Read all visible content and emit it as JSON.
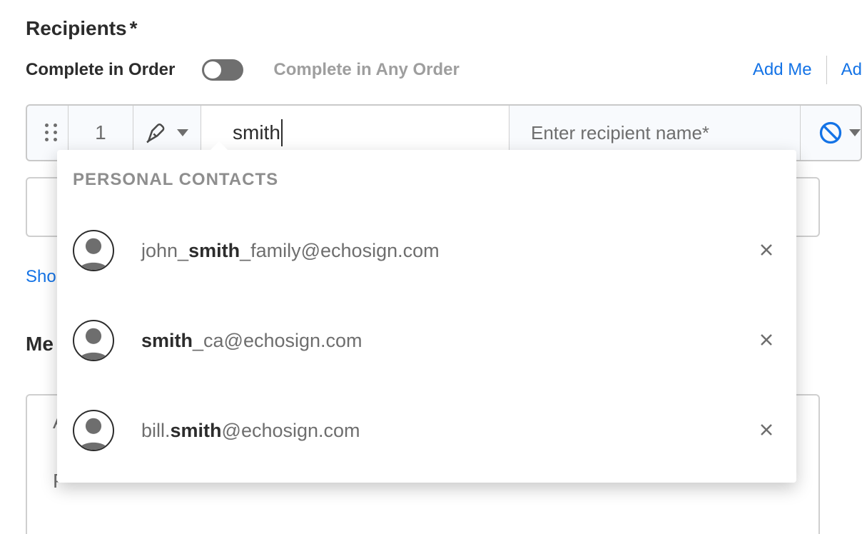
{
  "section": {
    "title": "Recipients",
    "required_mark": "*"
  },
  "order": {
    "on_label": "Complete in Order",
    "off_label": "Complete in Any Order",
    "toggle_on": true
  },
  "actions": {
    "add_me": "Add Me",
    "add_more": "Ad"
  },
  "recipient_row": {
    "index": "1",
    "email_input_value": "smith",
    "name_placeholder": "Enter recipient name*",
    "role_icon": "pen-sign-icon",
    "end_icon": "prohibit-icon"
  },
  "below": {
    "show_cc_prefix": "Sho",
    "message_heading_prefix": "Me",
    "ghost_row2_text_prefix": "A",
    "ghost_row3_text_prefix": "P"
  },
  "dropdown": {
    "header": "PERSONAL CONTACTS",
    "items": [
      {
        "prefix": "john_",
        "match": "smith",
        "suffix": "_family@echosign.com"
      },
      {
        "prefix": "",
        "match": "smith",
        "suffix": "_ca@echosign.com"
      },
      {
        "prefix": "bill.",
        "match": "smith",
        "suffix": "@echosign.com"
      }
    ]
  }
}
